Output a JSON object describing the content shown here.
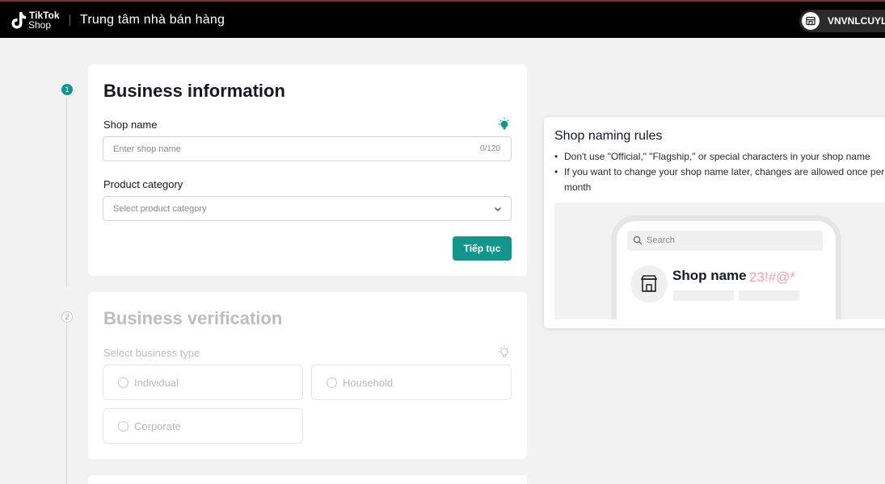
{
  "header": {
    "logo_line1": "TikTok",
    "logo_line2": "Shop",
    "title": "Trung tâm nhà bán hàng",
    "account_name": "VNVNLCUYLY"
  },
  "steps": [
    {
      "number": "1",
      "state": "active"
    },
    {
      "number": "2",
      "state": "inactive"
    }
  ],
  "business_info": {
    "title": "Business information",
    "shop_name_label": "Shop name",
    "shop_name_placeholder": "Enter shop name",
    "shop_name_counter": "0/120",
    "category_label": "Product category",
    "category_placeholder": "Select product category",
    "continue_label": "Tiếp tục"
  },
  "business_verification": {
    "title": "Business verification",
    "type_label": "Select business type",
    "options": [
      "Individual",
      "Household",
      "Corporate"
    ]
  },
  "naming_rules": {
    "title": "Shop naming rules",
    "rules": [
      "Don't use \"Official,\" \"Flagship,\" or special characters in your shop name",
      "If you want to change your shop name later, changes are allowed once per month"
    ],
    "preview": {
      "search_placeholder": "Search",
      "shop_name": "Shop name",
      "invalid_chars": "23!#@*"
    }
  },
  "colors": {
    "accent": "#12968c",
    "header_bg": "#000000",
    "page_bg": "#f2f2f2",
    "invalid_text": "#f1a0ad"
  },
  "icons": [
    "tiktok-logo-icon",
    "store-icon",
    "lightbulb-icon",
    "chevron-down-icon",
    "search-icon",
    "radio-icon"
  ]
}
